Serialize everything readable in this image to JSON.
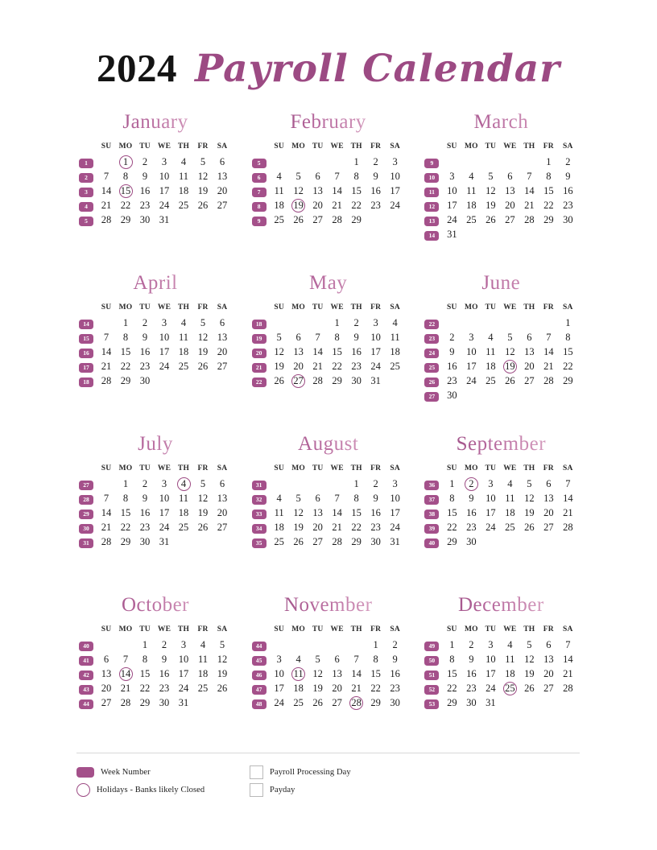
{
  "title": {
    "year": "2024",
    "script": "Payroll Calendar"
  },
  "colors": {
    "accent": "#a4508a",
    "accent_dark": "#8d3f76",
    "accent_light": "#eccbdc",
    "holiday_ring": "#9c4a83",
    "text": "#1d1d1d",
    "divider": "#d8d8d8"
  },
  "day_headers": [
    "SU",
    "MO",
    "TU",
    "WE",
    "TH",
    "FR",
    "SA"
  ],
  "months": [
    {
      "name": "January",
      "weeks": [
        {
          "number": "1",
          "days": [
            "",
            "1",
            "2",
            "3",
            "4",
            "5",
            "6"
          ]
        },
        {
          "number": "2",
          "days": [
            "7",
            "8",
            "9",
            "10",
            "11",
            "12",
            "13"
          ]
        },
        {
          "number": "3",
          "days": [
            "14",
            "15",
            "16",
            "17",
            "18",
            "19",
            "20"
          ]
        },
        {
          "number": "4",
          "days": [
            "21",
            "22",
            "23",
            "24",
            "25",
            "26",
            "27"
          ]
        },
        {
          "number": "5",
          "days": [
            "28",
            "29",
            "30",
            "31",
            "",
            "",
            ""
          ]
        }
      ],
      "holidays": [
        "1",
        "15"
      ]
    },
    {
      "name": "February",
      "weeks": [
        {
          "number": "5",
          "days": [
            "",
            "",
            "",
            "",
            "1",
            "2",
            "3"
          ]
        },
        {
          "number": "6",
          "days": [
            "4",
            "5",
            "6",
            "7",
            "8",
            "9",
            "10"
          ]
        },
        {
          "number": "7",
          "days": [
            "11",
            "12",
            "13",
            "14",
            "15",
            "16",
            "17"
          ]
        },
        {
          "number": "8",
          "days": [
            "18",
            "19",
            "20",
            "21",
            "22",
            "23",
            "24"
          ]
        },
        {
          "number": "9",
          "days": [
            "25",
            "26",
            "27",
            "28",
            "29",
            "",
            ""
          ]
        }
      ],
      "holidays": [
        "19"
      ]
    },
    {
      "name": "March",
      "weeks": [
        {
          "number": "9",
          "days": [
            "",
            "",
            "",
            "",
            "",
            "1",
            "2"
          ]
        },
        {
          "number": "10",
          "days": [
            "3",
            "4",
            "5",
            "6",
            "7",
            "8",
            "9"
          ]
        },
        {
          "number": "11",
          "days": [
            "10",
            "11",
            "12",
            "13",
            "14",
            "15",
            "16"
          ]
        },
        {
          "number": "12",
          "days": [
            "17",
            "18",
            "19",
            "20",
            "21",
            "22",
            "23"
          ]
        },
        {
          "number": "13",
          "days": [
            "24",
            "25",
            "26",
            "27",
            "28",
            "29",
            "30"
          ]
        },
        {
          "number": "14",
          "days": [
            "31",
            "",
            "",
            "",
            "",
            "",
            ""
          ]
        }
      ],
      "holidays": []
    },
    {
      "name": "April",
      "weeks": [
        {
          "number": "14",
          "days": [
            "",
            "1",
            "2",
            "3",
            "4",
            "5",
            "6"
          ]
        },
        {
          "number": "15",
          "days": [
            "7",
            "8",
            "9",
            "10",
            "11",
            "12",
            "13"
          ]
        },
        {
          "number": "16",
          "days": [
            "14",
            "15",
            "16",
            "17",
            "18",
            "19",
            "20"
          ]
        },
        {
          "number": "17",
          "days": [
            "21",
            "22",
            "23",
            "24",
            "25",
            "26",
            "27"
          ]
        },
        {
          "number": "18",
          "days": [
            "28",
            "29",
            "30",
            "",
            "",
            "",
            ""
          ]
        }
      ],
      "holidays": []
    },
    {
      "name": "May",
      "weeks": [
        {
          "number": "18",
          "days": [
            "",
            "",
            "",
            "1",
            "2",
            "3",
            "4"
          ]
        },
        {
          "number": "19",
          "days": [
            "5",
            "6",
            "7",
            "8",
            "9",
            "10",
            "11"
          ]
        },
        {
          "number": "20",
          "days": [
            "12",
            "13",
            "14",
            "15",
            "16",
            "17",
            "18"
          ]
        },
        {
          "number": "21",
          "days": [
            "19",
            "20",
            "21",
            "22",
            "23",
            "24",
            "25"
          ]
        },
        {
          "number": "22",
          "days": [
            "26",
            "27",
            "28",
            "29",
            "30",
            "31",
            ""
          ]
        }
      ],
      "holidays": [
        "27"
      ]
    },
    {
      "name": "June",
      "weeks": [
        {
          "number": "22",
          "days": [
            "",
            "",
            "",
            "",
            "",
            "",
            "1"
          ]
        },
        {
          "number": "23",
          "days": [
            "2",
            "3",
            "4",
            "5",
            "6",
            "7",
            "8"
          ]
        },
        {
          "number": "24",
          "days": [
            "9",
            "10",
            "11",
            "12",
            "13",
            "14",
            "15"
          ]
        },
        {
          "number": "25",
          "days": [
            "16",
            "17",
            "18",
            "19",
            "20",
            "21",
            "22"
          ]
        },
        {
          "number": "26",
          "days": [
            "23",
            "24",
            "25",
            "26",
            "27",
            "28",
            "29"
          ]
        },
        {
          "number": "27",
          "days": [
            "30",
            "",
            "",
            "",
            "",
            "",
            ""
          ]
        }
      ],
      "holidays": [
        "19"
      ]
    },
    {
      "name": "July",
      "weeks": [
        {
          "number": "27",
          "days": [
            "",
            "1",
            "2",
            "3",
            "4",
            "5",
            "6"
          ]
        },
        {
          "number": "28",
          "days": [
            "7",
            "8",
            "9",
            "10",
            "11",
            "12",
            "13"
          ]
        },
        {
          "number": "29",
          "days": [
            "14",
            "15",
            "16",
            "17",
            "18",
            "19",
            "20"
          ]
        },
        {
          "number": "30",
          "days": [
            "21",
            "22",
            "23",
            "24",
            "25",
            "26",
            "27"
          ]
        },
        {
          "number": "31",
          "days": [
            "28",
            "29",
            "30",
            "31",
            "",
            "",
            ""
          ]
        }
      ],
      "holidays": [
        "4"
      ]
    },
    {
      "name": "August",
      "weeks": [
        {
          "number": "31",
          "days": [
            "",
            "",
            "",
            "",
            "1",
            "2",
            "3"
          ]
        },
        {
          "number": "32",
          "days": [
            "4",
            "5",
            "6",
            "7",
            "8",
            "9",
            "10"
          ]
        },
        {
          "number": "33",
          "days": [
            "11",
            "12",
            "13",
            "14",
            "15",
            "16",
            "17"
          ]
        },
        {
          "number": "34",
          "days": [
            "18",
            "19",
            "20",
            "21",
            "22",
            "23",
            "24"
          ]
        },
        {
          "number": "35",
          "days": [
            "25",
            "26",
            "27",
            "28",
            "29",
            "30",
            "31"
          ]
        }
      ],
      "holidays": []
    },
    {
      "name": "September",
      "weeks": [
        {
          "number": "36",
          "days": [
            "1",
            "2",
            "3",
            "4",
            "5",
            "6",
            "7"
          ]
        },
        {
          "number": "37",
          "days": [
            "8",
            "9",
            "10",
            "11",
            "12",
            "13",
            "14"
          ]
        },
        {
          "number": "38",
          "days": [
            "15",
            "16",
            "17",
            "18",
            "19",
            "20",
            "21"
          ]
        },
        {
          "number": "39",
          "days": [
            "22",
            "23",
            "24",
            "25",
            "26",
            "27",
            "28"
          ]
        },
        {
          "number": "40",
          "days": [
            "29",
            "30",
            "",
            "",
            "",
            "",
            ""
          ]
        }
      ],
      "holidays": [
        "2"
      ]
    },
    {
      "name": "October",
      "weeks": [
        {
          "number": "40",
          "days": [
            "",
            "",
            "1",
            "2",
            "3",
            "4",
            "5"
          ]
        },
        {
          "number": "41",
          "days": [
            "6",
            "7",
            "8",
            "9",
            "10",
            "11",
            "12"
          ]
        },
        {
          "number": "42",
          "days": [
            "13",
            "14",
            "15",
            "16",
            "17",
            "18",
            "19"
          ]
        },
        {
          "number": "43",
          "days": [
            "20",
            "21",
            "22",
            "23",
            "24",
            "25",
            "26"
          ]
        },
        {
          "number": "44",
          "days": [
            "27",
            "28",
            "29",
            "30",
            "31",
            "",
            ""
          ]
        }
      ],
      "holidays": [
        "14"
      ]
    },
    {
      "name": "November",
      "weeks": [
        {
          "number": "44",
          "days": [
            "",
            "",
            "",
            "",
            "",
            "1",
            "2"
          ]
        },
        {
          "number": "45",
          "days": [
            "3",
            "4",
            "5",
            "6",
            "7",
            "8",
            "9"
          ]
        },
        {
          "number": "46",
          "days": [
            "10",
            "11",
            "12",
            "13",
            "14",
            "15",
            "16"
          ]
        },
        {
          "number": "47",
          "days": [
            "17",
            "18",
            "19",
            "20",
            "21",
            "22",
            "23"
          ]
        },
        {
          "number": "48",
          "days": [
            "24",
            "25",
            "26",
            "27",
            "28",
            "29",
            "30"
          ]
        }
      ],
      "holidays": [
        "11",
        "28"
      ]
    },
    {
      "name": "December",
      "weeks": [
        {
          "number": "49",
          "days": [
            "1",
            "2",
            "3",
            "4",
            "5",
            "6",
            "7"
          ]
        },
        {
          "number": "50",
          "days": [
            "8",
            "9",
            "10",
            "11",
            "12",
            "13",
            "14"
          ]
        },
        {
          "number": "51",
          "days": [
            "15",
            "16",
            "17",
            "18",
            "19",
            "20",
            "21"
          ]
        },
        {
          "number": "52",
          "days": [
            "22",
            "23",
            "24",
            "25",
            "26",
            "27",
            "28"
          ]
        },
        {
          "number": "53",
          "days": [
            "29",
            "30",
            "31",
            "",
            "",
            "",
            ""
          ]
        }
      ],
      "holidays": [
        "25"
      ]
    }
  ],
  "legend": [
    {
      "swatch": "week-number-swatch",
      "label": "Week Number"
    },
    {
      "swatch": "holiday-circle-swatch",
      "label": "Holidays - Banks likely Closed"
    },
    {
      "swatch": "payroll-processing-swatch",
      "label": "Payroll Processing Day"
    },
    {
      "swatch": "payday-swatch",
      "label": "Payday"
    }
  ]
}
